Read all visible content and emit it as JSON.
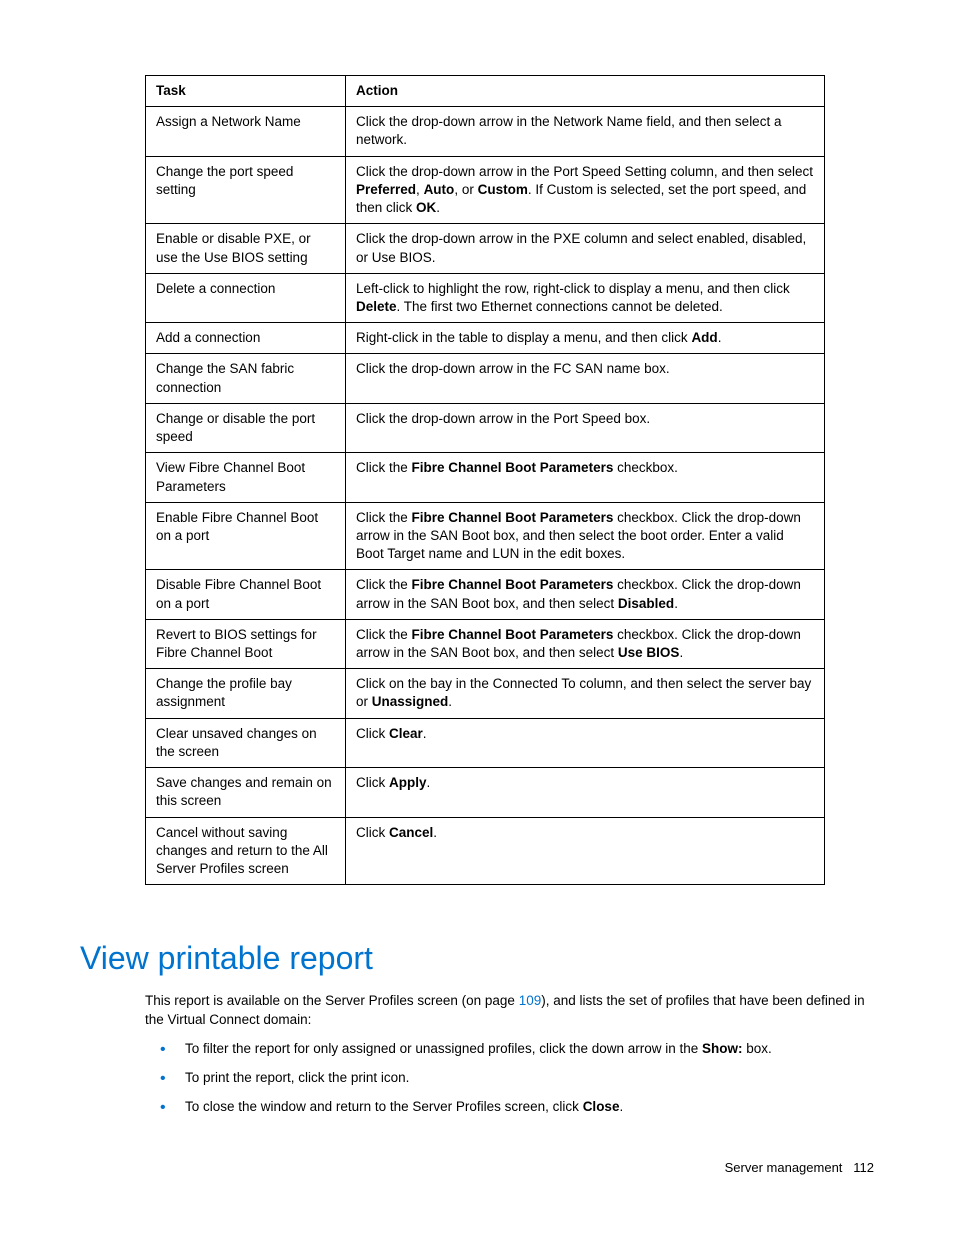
{
  "table": {
    "headers": {
      "task": "Task",
      "action": "Action"
    },
    "rows": [
      {
        "task": "Assign a Network Name",
        "action": "Click the drop-down arrow in the Network Name field, and then select a network."
      },
      {
        "task": "Change the port speed setting",
        "action": "Click the drop-down arrow in the Port Speed Setting column, and then select <b>Preferred</b>, <b>Auto</b>, or <b>Custom</b>. If Custom is selected, set the port speed, and then click <b>OK</b>."
      },
      {
        "task": "Enable or disable PXE, or use the Use BIOS setting",
        "action": "Click the drop-down arrow in the PXE column and select enabled, disabled, or Use BIOS."
      },
      {
        "task": "Delete a connection",
        "action": "Left-click to highlight the row, right-click to display a menu, and then click <b>Delete</b>. The first two Ethernet connections cannot be deleted."
      },
      {
        "task": "Add a connection",
        "action": "Right-click in the table to display a menu, and then click <b>Add</b>."
      },
      {
        "task": "Change the SAN fabric connection",
        "action": "Click the drop-down arrow in the FC SAN name box."
      },
      {
        "task": "Change or disable the port speed",
        "action": "Click the drop-down arrow in the Port Speed box."
      },
      {
        "task": "View Fibre Channel Boot Parameters",
        "action": "Click the <b>Fibre Channel Boot Parameters</b> checkbox."
      },
      {
        "task": "Enable Fibre Channel Boot on a port",
        "action": "Click the <b>Fibre Channel Boot Parameters</b> checkbox. Click the drop-down arrow in the SAN Boot box, and then select the boot order. Enter a valid Boot Target name and LUN in the edit boxes."
      },
      {
        "task": "Disable Fibre Channel Boot on a port",
        "action": "Click the <b>Fibre Channel Boot Parameters</b> checkbox. Click the drop-down arrow in the SAN Boot box, and then select <b>Disabled</b>."
      },
      {
        "task": "Revert to BIOS settings for Fibre Channel Boot",
        "action": "Click the <b>Fibre Channel Boot Parameters</b> checkbox. Click the drop-down arrow in the SAN Boot box, and then select <b>Use BIOS</b>."
      },
      {
        "task": "Change the profile bay assignment",
        "action": "Click on the bay in the Connected To column, and then select the server bay or <b>Unassigned</b>."
      },
      {
        "task": "Clear unsaved changes on the screen",
        "action": "Click <b>Clear</b>."
      },
      {
        "task": "Save changes and remain on this screen",
        "action": "Click <b>Apply</b>."
      },
      {
        "task": "Cancel without saving changes and return to the All Server Profiles screen",
        "action": "Click <b>Cancel</b>."
      }
    ]
  },
  "section": {
    "title": "View printable report",
    "intro_pre": "This report is available on the Server Profiles screen (on page ",
    "intro_link": "109",
    "intro_post": "), and lists the set of profiles that have been defined in the Virtual Connect domain:",
    "bullets": [
      "To filter the report for only assigned or unassigned profiles, click the down arrow in the <b>Show:</b> box.",
      "To print the report, click the print icon.",
      "To close the window and return to the Server Profiles screen, click <b>Close</b>."
    ]
  },
  "footer": {
    "section": "Server management",
    "page": "112"
  }
}
